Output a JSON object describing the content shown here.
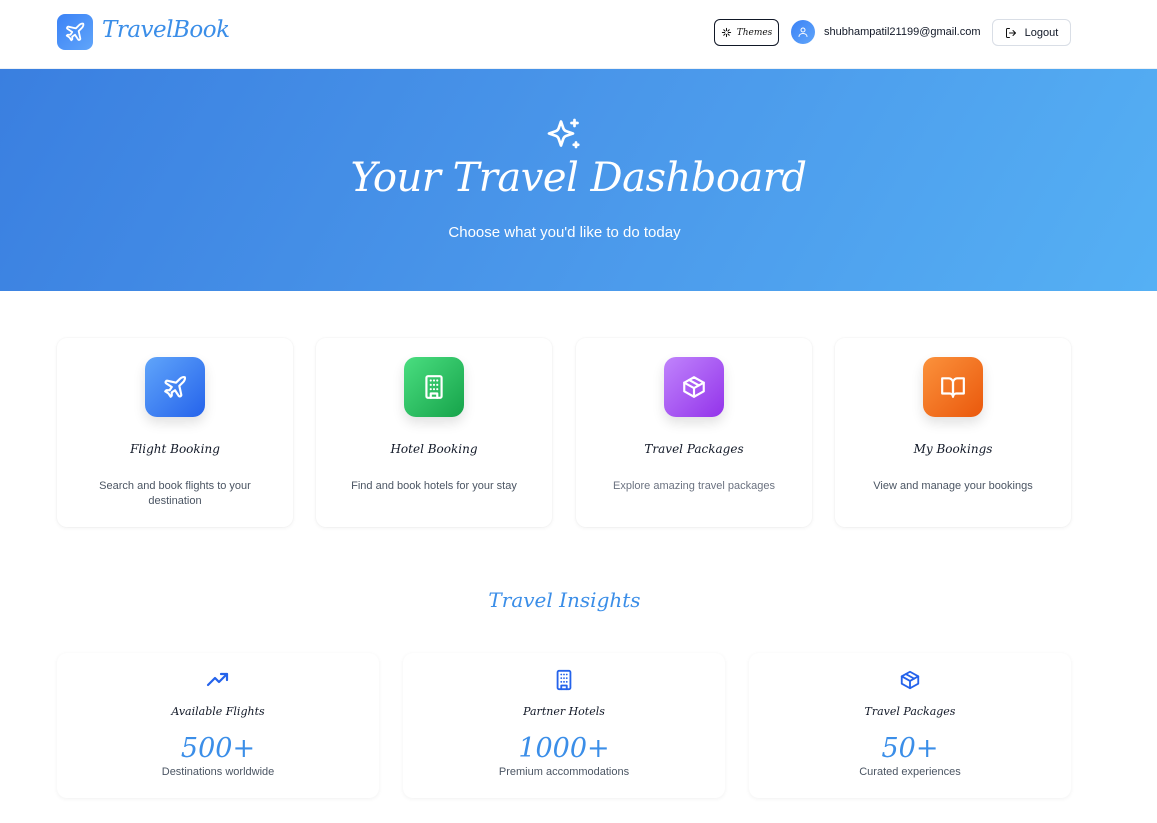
{
  "header": {
    "logo_text": "TravelBook",
    "themes_label": "Themes",
    "user_email": "shubhampatil21199@gmail.com",
    "logout_label": "Logout"
  },
  "hero": {
    "title": "Your Travel Dashboard",
    "subtitle": "Choose what you'd like to do today"
  },
  "features": [
    {
      "title": "Flight Booking",
      "description": "Search and book flights to your destination",
      "icon": "plane-icon",
      "color_from": "#3b82f6",
      "color_to": "#2563eb"
    },
    {
      "title": "Hotel Booking",
      "description": "Find and book hotels for your stay",
      "icon": "building-icon",
      "color_from": "#22c55e",
      "color_to": "#16a34a"
    },
    {
      "title": "Travel Packages",
      "description": "Explore amazing travel packages",
      "icon": "package-icon",
      "color_from": "#c084fc",
      "color_to": "#9333ea"
    },
    {
      "title": "My Bookings",
      "description": "View and manage your bookings",
      "icon": "book-open-icon",
      "color_from": "#fb923c",
      "color_to": "#ea580c"
    }
  ],
  "insights": {
    "title": "Travel Insights",
    "stats": [
      {
        "title": "Available Flights",
        "value": "500+",
        "description": "Destinations worldwide",
        "icon": "trending-up-icon"
      },
      {
        "title": "Partner Hotels",
        "value": "1000+",
        "description": "Premium accommodations",
        "icon": "building-icon"
      },
      {
        "title": "Travel Packages",
        "value": "50+",
        "description": "Curated experiences",
        "icon": "package-icon"
      }
    ]
  },
  "colors": {
    "accent": "#3b8ee8",
    "hero_gradient_start": "#3a7fe0",
    "hero_gradient_end": "#55b0f4"
  }
}
